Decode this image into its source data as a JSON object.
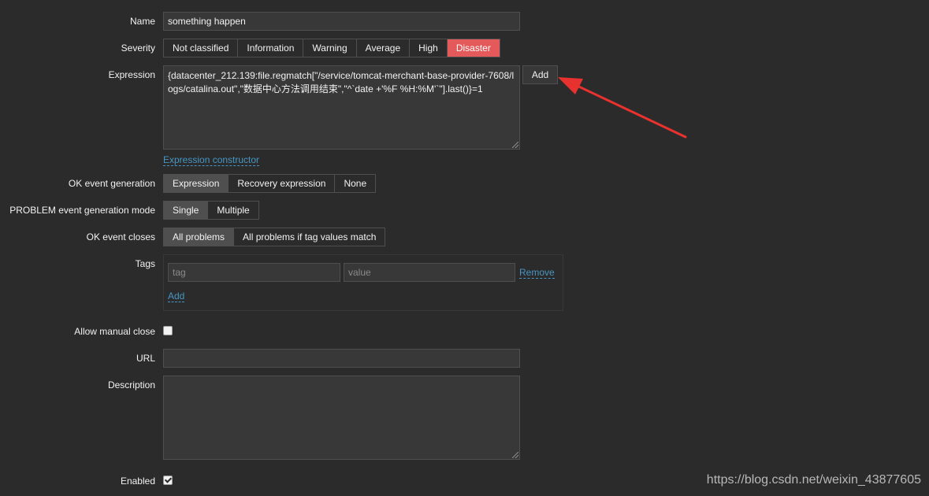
{
  "form": {
    "name": {
      "label": "Name",
      "value": "something happen"
    },
    "severity": {
      "label": "Severity",
      "options": [
        "Not classified",
        "Information",
        "Warning",
        "Average",
        "High",
        "Disaster"
      ],
      "selected": "Disaster",
      "selected_color": "#e45959"
    },
    "expression": {
      "label": "Expression",
      "value": "{datacenter_212.139:file.regmatch[\"/service/tomcat-merchant-base-provider-7608/logs/catalina.out\",\"数据中心方法调用结束\",\"^`date +'%F %H:%M'`\"].last()}=1",
      "add_label": "Add",
      "constructor_link": "Expression constructor"
    },
    "ok_event_generation": {
      "label": "OK event generation",
      "options": [
        "Expression",
        "Recovery expression",
        "None"
      ],
      "selected": "Expression"
    },
    "problem_mode": {
      "label": "PROBLEM event generation mode",
      "options": [
        "Single",
        "Multiple"
      ],
      "selected": "Single"
    },
    "ok_event_closes": {
      "label": "OK event closes",
      "options": [
        "All problems",
        "All problems if tag values match"
      ],
      "selected": "All problems"
    },
    "tags": {
      "label": "Tags",
      "tag_placeholder": "tag",
      "value_placeholder": "value",
      "remove_label": "Remove",
      "add_label": "Add"
    },
    "allow_manual_close": {
      "label": "Allow manual close",
      "checked": false
    },
    "url": {
      "label": "URL",
      "value": ""
    },
    "description": {
      "label": "Description",
      "value": ""
    },
    "enabled": {
      "label": "Enabled",
      "checked": true
    }
  },
  "watermark": "https://blog.csdn.net/weixin_43877605",
  "colors": {
    "background": "#2b2b2b",
    "input_bg": "#383838",
    "border": "#4f4f4f",
    "link": "#4796c4",
    "disaster": "#e45959",
    "arrow": "#e8322f"
  }
}
